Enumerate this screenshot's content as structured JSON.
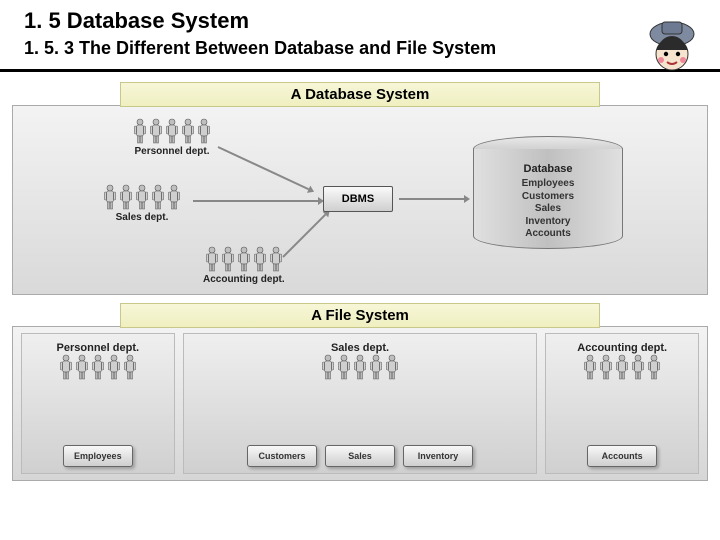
{
  "header": {
    "title": "1. 5 Database System",
    "subtitle": "1. 5. 3 The Different Between Database and File System"
  },
  "db_section": {
    "title": "A Database System",
    "depts": {
      "personnel": "Personnel dept.",
      "sales": "Sales dept.",
      "accounting": "Accounting dept."
    },
    "dbms_label": "DBMS",
    "database_title": "Database",
    "database_items": [
      "Employees",
      "Customers",
      "Sales",
      "Inventory",
      "Accounts"
    ]
  },
  "fs_section": {
    "title": "A File System",
    "cols": [
      {
        "dept": "Personnel dept.",
        "resources": [
          "Employees"
        ]
      },
      {
        "dept": "Sales dept.",
        "resources": [
          "Customers",
          "Sales",
          "Inventory"
        ]
      },
      {
        "dept": "Accounting dept.",
        "resources": [
          "Accounts"
        ]
      }
    ]
  }
}
